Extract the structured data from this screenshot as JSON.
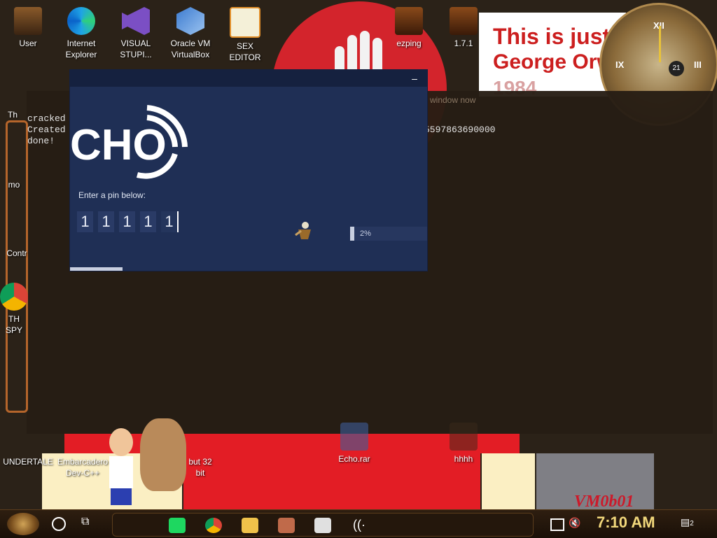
{
  "desktop": {
    "icons": [
      {
        "label": "User"
      },
      {
        "label": "Internet\nExplorer"
      },
      {
        "label": "VISUAL\nSTUPI..."
      },
      {
        "label": "Oracle VM\nVirtualBox"
      },
      {
        "label": "SEX\nEDITOR"
      },
      {
        "label": "ezping"
      },
      {
        "label": "1.7.1"
      },
      {
        "label": "UNDERTALE"
      },
      {
        "label": "Embarcadero\nDev-C++"
      },
      {
        "label": "but 32\nbit"
      },
      {
        "label": "Echo.rar"
      },
      {
        "label": "hhhh"
      }
    ],
    "partial_labels": [
      "Th",
      "mo",
      "Contr",
      "TH\nSPY"
    ],
    "poster_lines": [
      "This is just",
      "George Orwell's",
      "1984"
    ],
    "wallpaper_text": "VM0b01",
    "clock_date": "21"
  },
  "terminal": {
    "lines": [
      "cracked",
      "Created",
      "done!"
    ],
    "right_text": "5597863690000",
    "bg_title_fragment": "window now"
  },
  "echo_app": {
    "logo_text": "CHO",
    "prompt": "Enter a pin below:",
    "pin_digits": [
      "1",
      "1",
      "1",
      "1",
      "1"
    ],
    "progress_percent": 2,
    "progress_label": "2%",
    "minimize_label": "–"
  },
  "taskbar": {
    "time": "7:10 AM",
    "notification_count": "2",
    "pinned_apps": [
      "spotify-like-app",
      "chrome",
      "file-explorer",
      "game-app",
      "media-app",
      "echo-app"
    ]
  }
}
